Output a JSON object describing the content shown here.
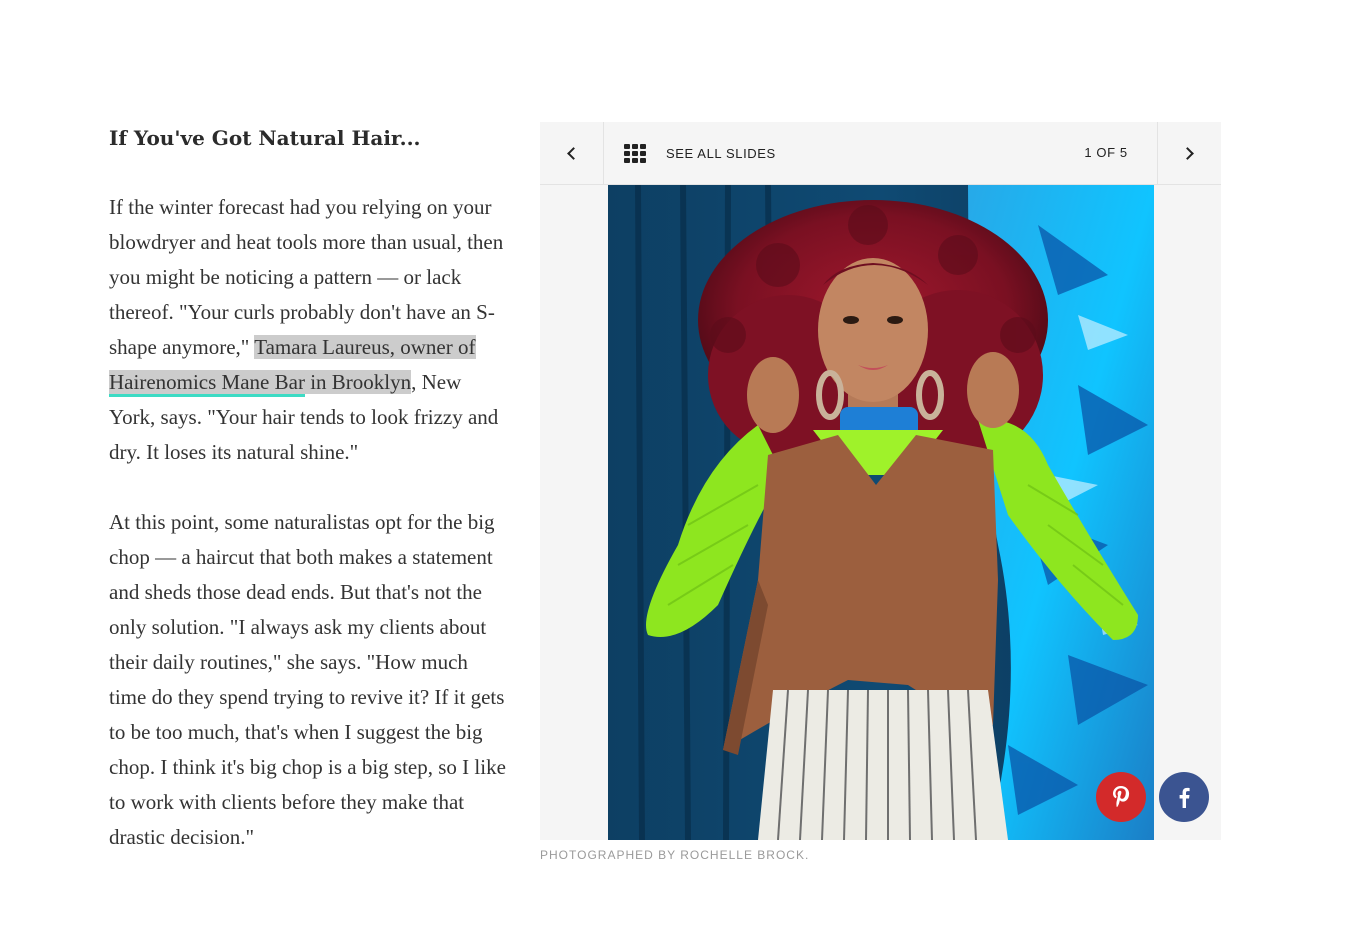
{
  "article": {
    "heading": "If You've Got Natural Hair...",
    "p1_before": "If the winter forecast had you relying on your blowdryer and heat tools more than usual, then you might be noticing a pattern — or lack thereof. \"Your curls probably don't have an S-shape anymore,\" ",
    "p1_hl_plain": "Tamara Laureus, owner of ",
    "p1_hl_link": "Hairenomics Mane Bar",
    "p1_hl_end": " in Brooklyn",
    "p1_after": ", New York, says. \"Your hair tends to look frizzy and dry. It loses its natural shine.\"",
    "p2": "At this point, some naturalistas opt for the big chop — a haircut that both makes a statement and sheds those dead ends. But that's not the only solution. \"I always ask my clients about their daily routines,\" she says. \"How much time do they spend trying to revive it? If it gets to be too much, that's when I suggest the big chop. I think it's big chop is a big step, so I like to work with clients before they make that drastic decision.\""
  },
  "slideshow": {
    "see_all_label": "SEE ALL SLIDES",
    "counter": "1 OF 5",
    "caption": "PHOTOGRAPHED BY ROCHELLE BROCK.",
    "icons": {
      "prev": "chevron-left-icon",
      "next": "chevron-right-icon",
      "grid": "grid-icon",
      "pinterest": "pinterest-icon",
      "facebook": "facebook-icon"
    }
  },
  "colors": {
    "highlight": "#cccccc",
    "link_underline": "#3ddbc4",
    "pinterest": "#d32a2a",
    "facebook": "#3b5491"
  }
}
